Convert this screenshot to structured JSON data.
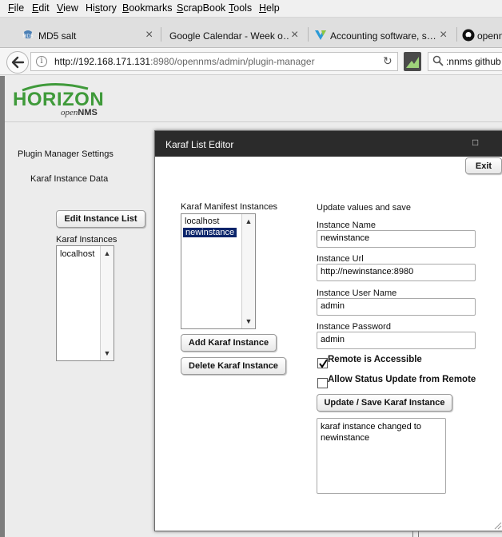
{
  "menubar": {
    "items": [
      {
        "label": "File",
        "mnemonic": "F",
        "rest": "ile"
      },
      {
        "label": "Edit",
        "mnemonic": "E",
        "rest": "dit"
      },
      {
        "label": "View",
        "mnemonic": "V",
        "rest": "iew"
      },
      {
        "label": "History",
        "mnemonic": "s",
        "pre": "Hi",
        "rest": "tory"
      },
      {
        "label": "Bookmarks",
        "mnemonic": "B",
        "rest": "ookmarks"
      },
      {
        "label": "ScrapBook",
        "mnemonic": "S",
        "pre": "",
        "rest": "crapBook"
      },
      {
        "label": "Tools",
        "mnemonic": "T",
        "rest": "ools"
      },
      {
        "label": "Help",
        "mnemonic": "H",
        "rest": "elp"
      }
    ]
  },
  "tabs": [
    {
      "label": "MD5 salt",
      "close": "×"
    },
    {
      "label": "Google Calendar - Week o…",
      "close": "×"
    },
    {
      "label": "Accounting software, s…",
      "close": "×"
    },
    {
      "label": "openn"
    }
  ],
  "nav": {
    "url_host": "http://192.168.171.131",
    "url_rest": ":8980/opennms/admin/plugin-manager",
    "search_value": ":nnms github"
  },
  "brand": {
    "logo_main": "HORIZON",
    "logo_sub_open": "open",
    "logo_sub_nms": "NMS",
    "accent_green": "#3f9a3a"
  },
  "left": {
    "plugin_settings": "Plugin Manager Settings",
    "instance_data": "Karaf Instance Data",
    "edit_list_button": "Edit Instance List",
    "karaf_instances_label": "Karaf Instances",
    "karaf_instances": [
      "localhost"
    ]
  },
  "dialog": {
    "title": "Karaf List Editor",
    "maximize_glyph": "□",
    "exit_button": "Exit",
    "manifest_label": "Karaf Manifest Instances",
    "manifest_items": [
      "localhost",
      "newinstance"
    ],
    "selected_index": 1,
    "add_button": "Add Karaf Instance",
    "delete_button": "Delete Karaf Instance",
    "update_heading": "Update values and save",
    "instance_name_label": "Instance Name",
    "instance_name_value": "newinstance",
    "instance_url_label": "Instance Url",
    "instance_url_value": "http://newinstance:8980",
    "instance_user_label": "Instance User Name",
    "instance_user_value": "admin",
    "instance_password_label": "Instance Password",
    "instance_password_value": "admin",
    "remote_accessible_label": "Remote is Accessible",
    "remote_accessible_checked": true,
    "allow_status_label": "Allow Status Update from Remote",
    "allow_status_checked": false,
    "update_save_button": "Update / Save Karaf Instance",
    "status_message": "karaf instance changed to newinstance"
  }
}
